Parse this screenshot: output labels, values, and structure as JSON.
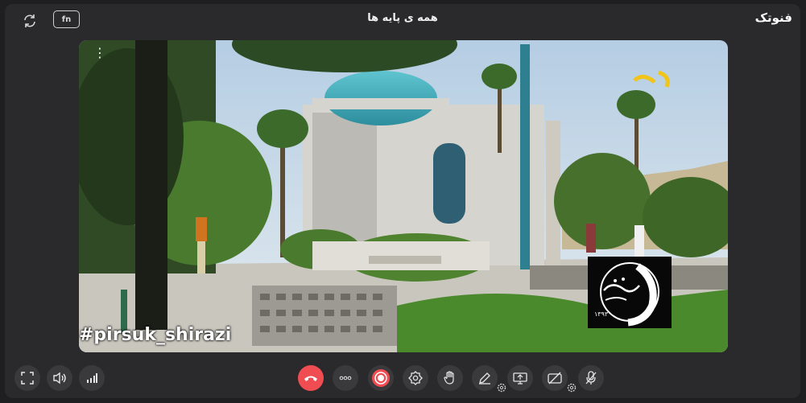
{
  "header": {
    "title": "همه ی پایه ها",
    "brand": "فنوتک",
    "translate_label": "fn"
  },
  "video": {
    "hashtag": "#pirsuk_shirazi",
    "logo_year": "۱۳۹۳"
  },
  "controls": {
    "left": [
      "fullscreen-icon",
      "volume-icon",
      "signal-icon"
    ],
    "center": [
      "end-call-icon",
      "more-icon",
      "record-icon",
      "settings-icon",
      "raise-hand-icon",
      "pen-icon",
      "screen-share-icon",
      "camera-off-icon",
      "mic-off-icon"
    ]
  },
  "colors": {
    "end_call": "#f04d52",
    "record": "#f04d52",
    "background": "#2a2a2c"
  }
}
